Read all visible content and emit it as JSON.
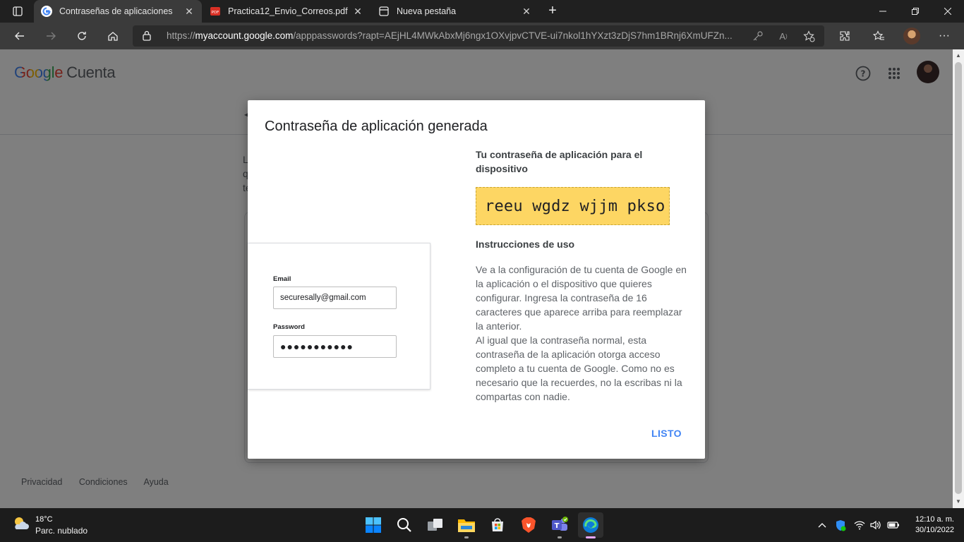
{
  "browser": {
    "tabs": [
      {
        "label": "Contraseñas de aplicaciones",
        "icon": "google-g-icon",
        "active": true
      },
      {
        "label": "Practica12_Envio_Correos.pdf",
        "icon": "pdf-icon",
        "active": false
      },
      {
        "label": "Nueva pestaña",
        "icon": "new-tab-page-icon",
        "active": false
      }
    ],
    "url_prefix": "https://",
    "url_domain": "myaccount.google.com",
    "url_rest": "/apppasswords?rapt=AEjHL4MWkAbxMj6ngx1OXvjpvCTVE-ui7nkol1hYXzt3zDjS7hm1BRnj6XmUFZn..."
  },
  "header": {
    "logo_text": "Google",
    "product": "Cuenta"
  },
  "background": {
    "text_lines": [
      "L",
      "q",
      "te"
    ]
  },
  "footer": {
    "links": [
      "Privacidad",
      "Condiciones",
      "Ayuda"
    ]
  },
  "dialog": {
    "title": "Contraseña de aplicación generada",
    "mock": {
      "email_label": "Email",
      "email_value": "securesally@gmail.com",
      "password_label": "Password",
      "password_value": "●●●●●●●●●●●"
    },
    "password_heading": "Tu contraseña de aplicación para el dispositivo",
    "generated_password": "reeu wgdz wjjm pkso",
    "instructions_heading": "Instrucciones de uso",
    "instructions_p1": "Ve a la configuración de tu cuenta de Google en la aplicación o el dispositivo que quieres configurar. Ingresa la contraseña de 16 caracteres que aparece arriba para reemplazar la anterior.",
    "instructions_p2": "Al igual que la contraseña normal, esta contraseña de la aplicación otorga acceso completo a tu cuenta de Google. Como no es necesario que la recuerdes, no la escribas ni la compartas con nadie.",
    "done_label": "LISTO"
  },
  "taskbar": {
    "temperature": "18°C",
    "weather": "Parc. nublado",
    "time": "12:10 a. m.",
    "date": "30/10/2022"
  },
  "colors": {
    "accent_blue": "#4285f4",
    "password_highlight": "#fdd663",
    "tab_bar": "#202020",
    "toolbar": "#3b3b3b"
  }
}
